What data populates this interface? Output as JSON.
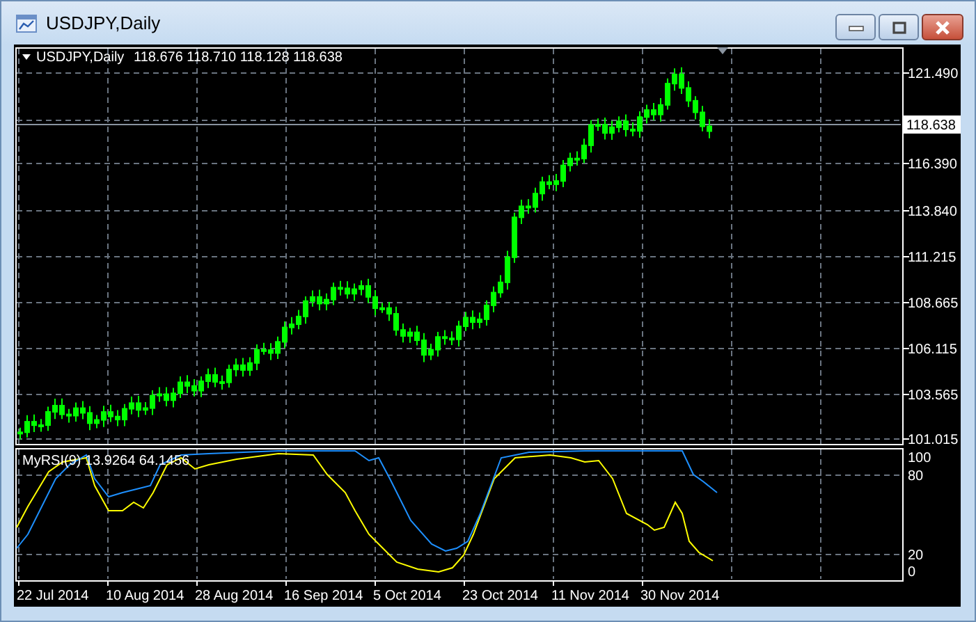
{
  "window": {
    "title": "USDJPY,Daily"
  },
  "chart": {
    "symbol": "USDJPY,Daily",
    "ohlc": "118.676 118.710 118.128 118.638",
    "current_price": "118.638",
    "price_axis": [
      "121.490",
      "116.390",
      "113.840",
      "111.215",
      "108.665",
      "106.115",
      "103.565",
      "101.015"
    ]
  },
  "indicator": {
    "legend": "MyRSI(9) 13.9264 64.1456",
    "axis": [
      "100",
      "80",
      "20",
      "0"
    ]
  },
  "time_axis": [
    "22 Jul 2014",
    "10 Aug 2014",
    "28 Aug 2014",
    "16 Sep 2014",
    "5 Oct 2014",
    "23 Oct 2014",
    "11 Nov 2014",
    "30 Nov 2014"
  ]
}
